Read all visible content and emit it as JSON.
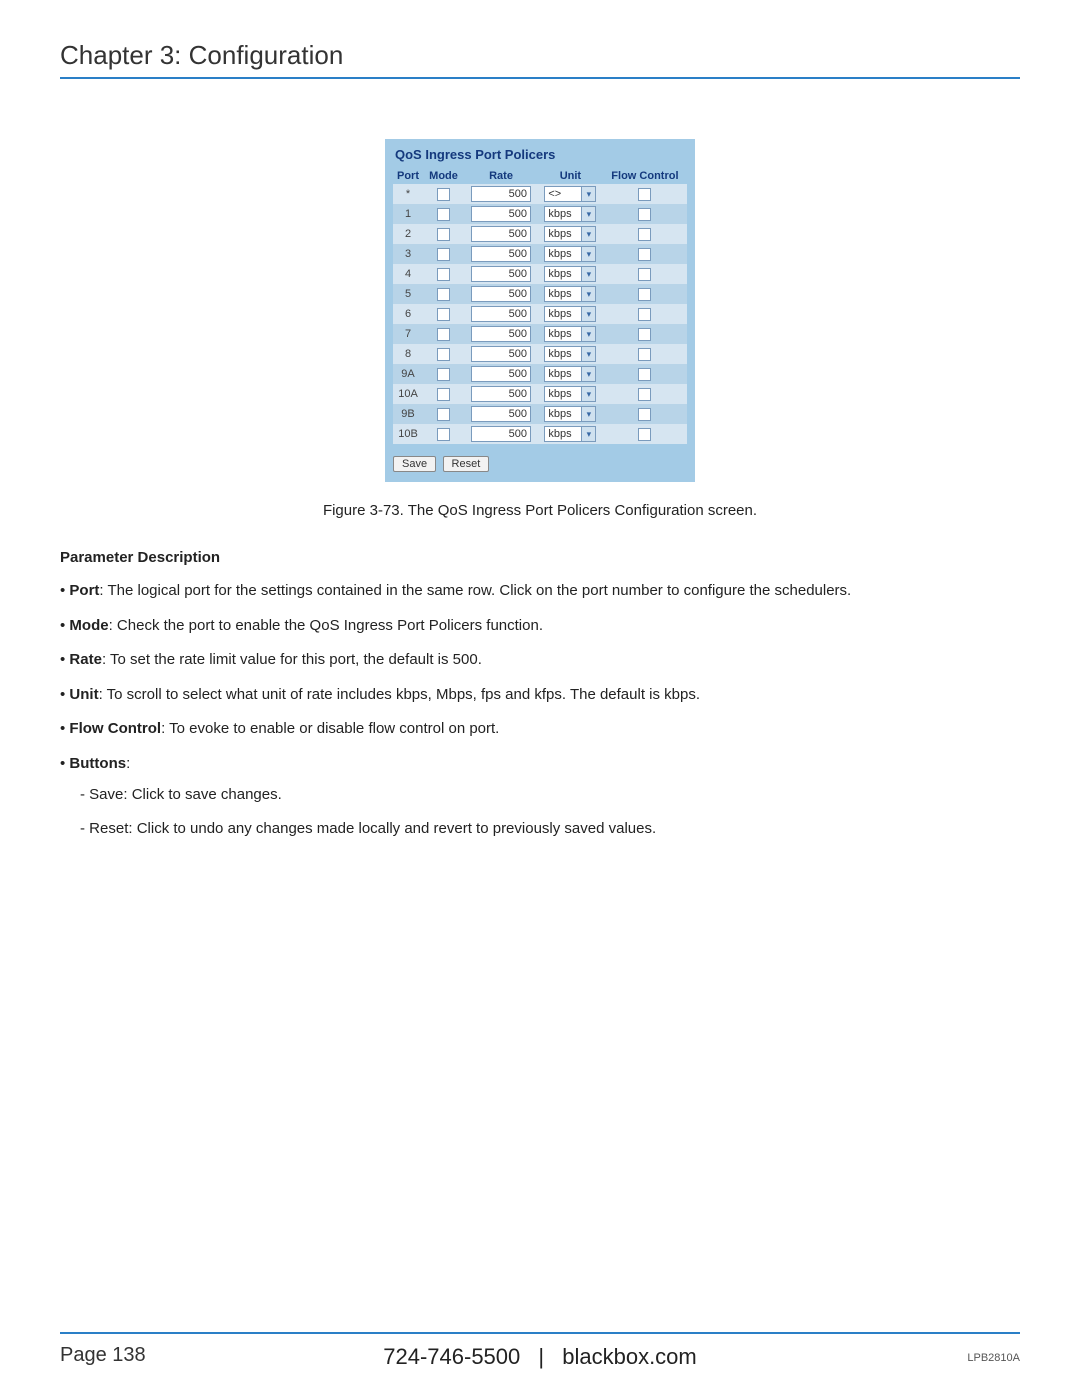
{
  "chapter_title": "Chapter 3: Configuration",
  "screenshot": {
    "title": "QoS Ingress Port Policers",
    "columns": [
      "Port",
      "Mode",
      "Rate",
      "Unit",
      "Flow Control"
    ],
    "rows": [
      {
        "port": "*",
        "rate": "500",
        "unit": "<>"
      },
      {
        "port": "1",
        "rate": "500",
        "unit": "kbps"
      },
      {
        "port": "2",
        "rate": "500",
        "unit": "kbps"
      },
      {
        "port": "3",
        "rate": "500",
        "unit": "kbps"
      },
      {
        "port": "4",
        "rate": "500",
        "unit": "kbps"
      },
      {
        "port": "5",
        "rate": "500",
        "unit": "kbps"
      },
      {
        "port": "6",
        "rate": "500",
        "unit": "kbps"
      },
      {
        "port": "7",
        "rate": "500",
        "unit": "kbps"
      },
      {
        "port": "8",
        "rate": "500",
        "unit": "kbps"
      },
      {
        "port": "9A",
        "rate": "500",
        "unit": "kbps"
      },
      {
        "port": "10A",
        "rate": "500",
        "unit": "kbps"
      },
      {
        "port": "9B",
        "rate": "500",
        "unit": "kbps"
      },
      {
        "port": "10B",
        "rate": "500",
        "unit": "kbps"
      }
    ],
    "buttons": {
      "save": "Save",
      "reset": "Reset"
    }
  },
  "figure_caption": "Figure 3-73. The QoS Ingress Port Policers Configuration screen.",
  "param_desc_head": "Parameter Description",
  "params": [
    {
      "label": "Port",
      "text": ": The logical port for the settings contained in the same row. Click on the port number to configure the schedulers."
    },
    {
      "label": "Mode",
      "text": ": Check the port to enable the QoS Ingress Port Policers function."
    },
    {
      "label": "Rate",
      "text": ": To set the rate limit value for this port, the default is 500."
    },
    {
      "label": "Unit",
      "text": ": To scroll to select what unit of rate includes kbps, Mbps, fps and kfps. The default is kbps."
    },
    {
      "label": "Flow Control",
      "text": ": To evoke to enable or disable flow control on port."
    },
    {
      "label": "Buttons",
      "text": ":"
    }
  ],
  "sub_buttons": [
    "Save: Click to save changes.",
    "Reset: Click to undo any changes made locally and revert to previously saved values."
  ],
  "footer": {
    "page": "Page 138",
    "phone": "724-746-5500",
    "sep": "|",
    "site": "blackbox.com",
    "model": "LPB2810A"
  }
}
